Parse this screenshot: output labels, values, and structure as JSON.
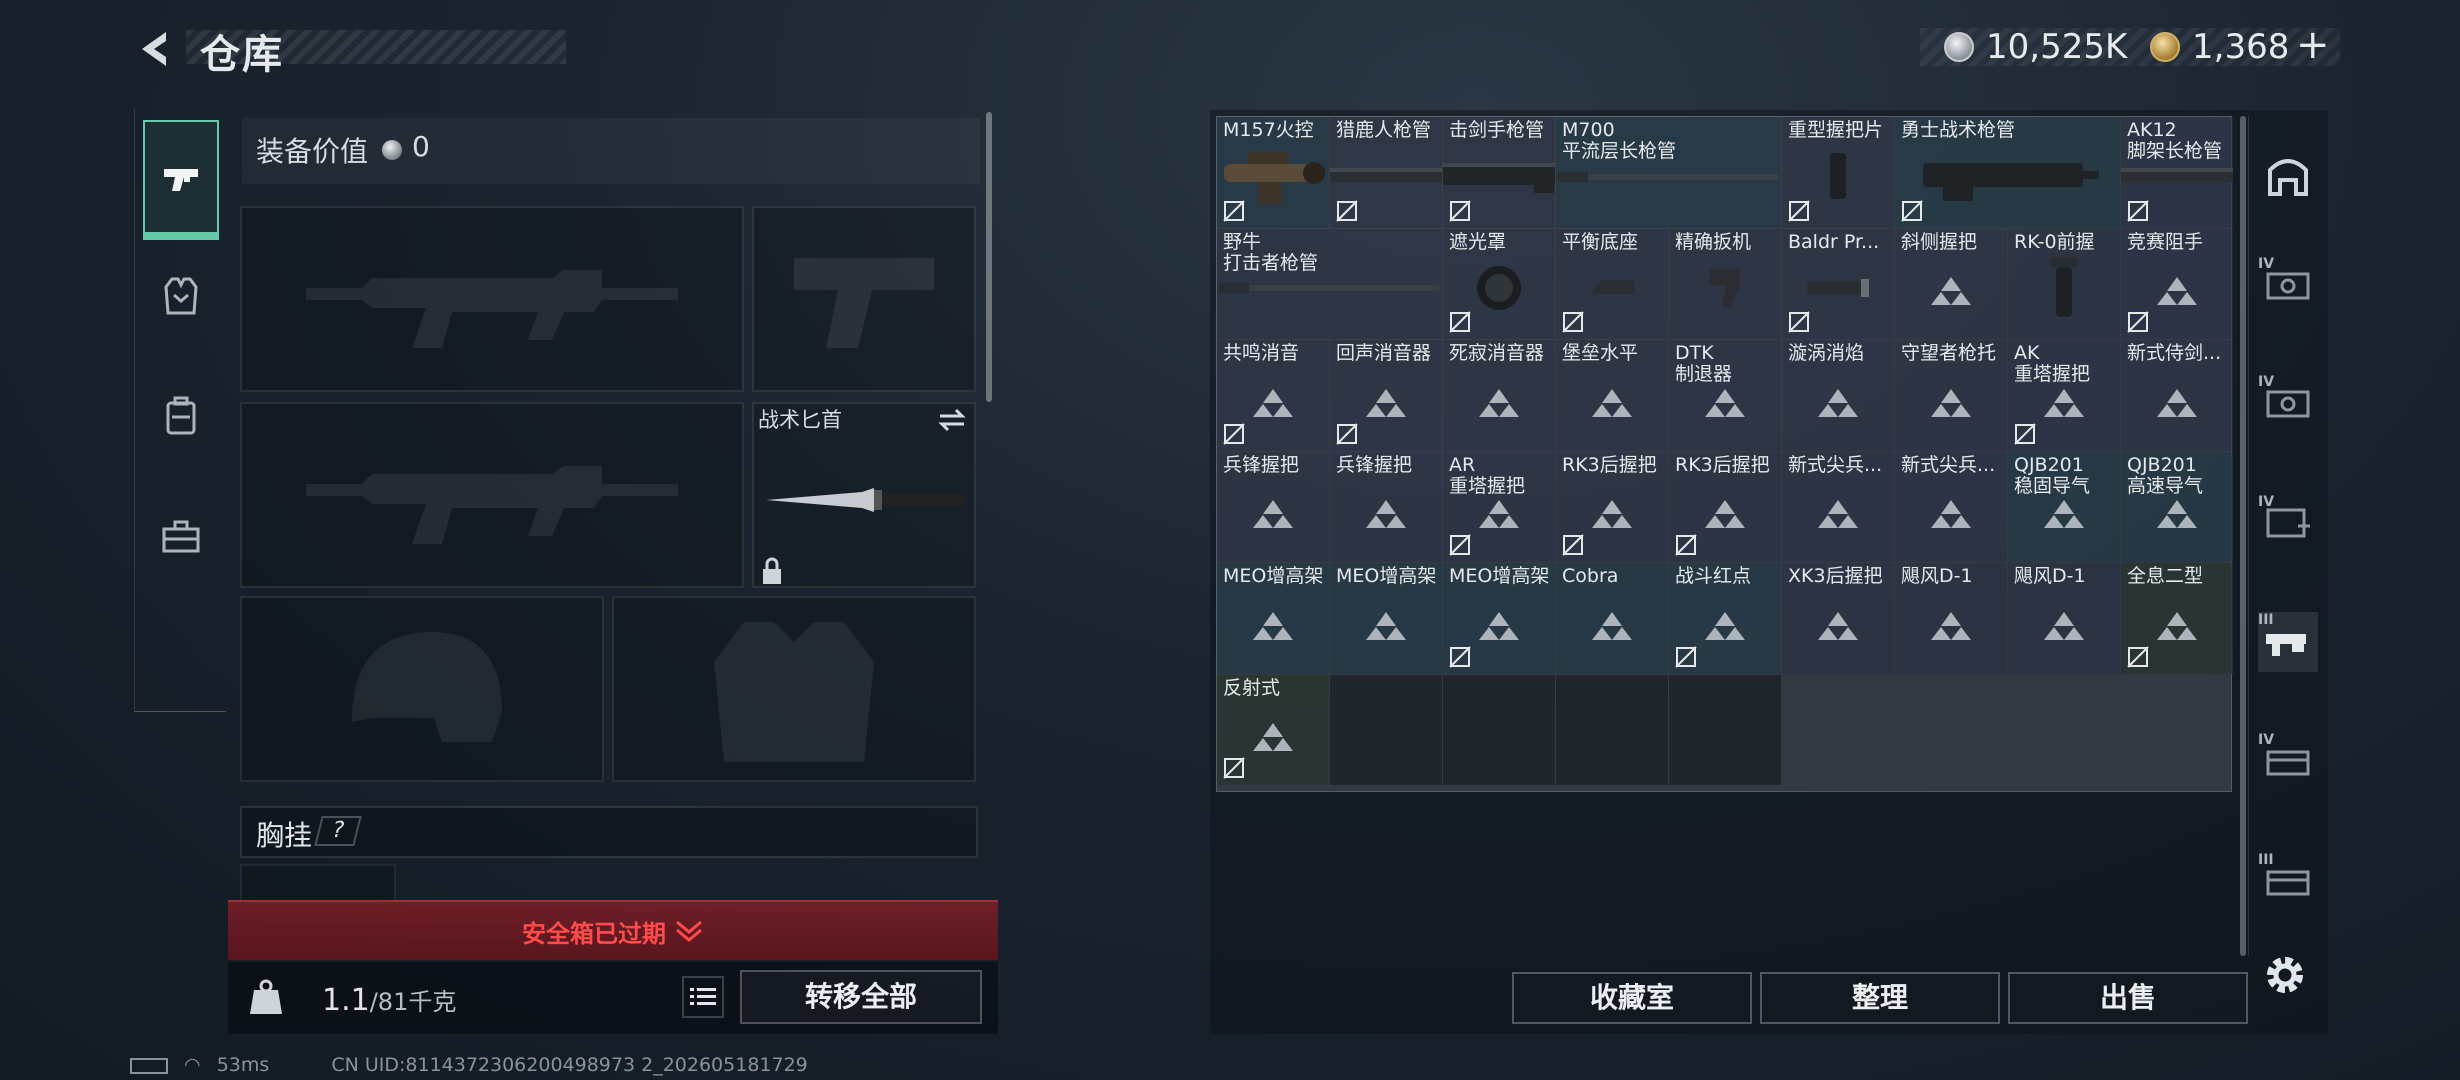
{
  "header": {
    "title": "仓库"
  },
  "currency": {
    "silver": "10,525K",
    "gold": "1,368",
    "plus": "+"
  },
  "loadout": {
    "equip_value_label": "装备价值",
    "equip_value": "0",
    "knife_label": "战术匕首",
    "chest_label": "胸挂",
    "chest_help": "?",
    "safe_expired": "安全箱已过期",
    "weight_current": "1.1",
    "weight_max": "/81千克",
    "transfer_all": "转移全部"
  },
  "inventory": {
    "rows": [
      [
        {
          "name": "M157火控",
          "style": "teal",
          "icon": "scope",
          "flag": true
        },
        {
          "name": "猎鹿人枪管",
          "icon": "rail",
          "flag": true
        },
        {
          "name": "击剑手枪管",
          "icon": "rail-heavy",
          "flag": true
        },
        {
          "name": "M700\n平流层长枪管",
          "style": "teal",
          "icon": "barrel",
          "span": 2
        },
        {
          "name": "重型握把片",
          "icon": "grip-plate",
          "flag": true
        }
      ],
      [
        {
          "name": "勇士战术枪管",
          "style": "teal",
          "icon": "handguard",
          "flag": true,
          "span": 2
        },
        {
          "name": "AK12\n脚架长枪管",
          "icon": "rail",
          "flag": true
        },
        {
          "name": "野牛\n打击者枪管",
          "icon": "barrel",
          "span": 2
        },
        {
          "name": "遮光罩",
          "icon": "hood",
          "flag": true
        },
        {
          "name": "平衡底座",
          "icon": "mount",
          "flag": true
        },
        {
          "name": "精确扳机",
          "icon": "trigger"
        }
      ],
      [
        {
          "name": "Baldr Pr...",
          "icon": "light",
          "flag": true
        },
        {
          "name": "斜侧握把",
          "icon": "placeholder"
        },
        {
          "name": "RK-0前握",
          "icon": "vgrip"
        },
        {
          "name": "竞赛阻手",
          "icon": "placeholder",
          "flag": true
        },
        {
          "name": "共鸣消音",
          "icon": "placeholder",
          "flag": true
        },
        {
          "name": "回声消音器",
          "icon": "placeholder",
          "flag": true
        },
        {
          "name": "死寂消音器",
          "icon": "placeholder"
        },
        {
          "name": "堡垒水平",
          "icon": "placeholder"
        },
        {
          "name": "DTK\n制退器",
          "icon": "placeholder"
        }
      ],
      [
        {
          "name": "漩涡消焰",
          "icon": "placeholder"
        },
        {
          "name": "守望者枪托",
          "icon": "placeholder"
        },
        {
          "name": "AK\n重塔握把",
          "icon": "placeholder",
          "flag": true
        },
        {
          "name": "新式侍剑...",
          "icon": "placeholder"
        },
        {
          "name": "兵锋握把",
          "icon": "placeholder"
        },
        {
          "name": "兵锋握把",
          "icon": "placeholder"
        },
        {
          "name": "AR\n重塔握把",
          "icon": "placeholder",
          "flag": true
        },
        {
          "name": "RK3后握把",
          "icon": "placeholder",
          "flag": true
        },
        {
          "name": "RK3后握把",
          "icon": "placeholder",
          "flag": true
        }
      ],
      [
        {
          "name": "新式尖兵...",
          "icon": "placeholder"
        },
        {
          "name": "新式尖兵...",
          "icon": "placeholder"
        },
        {
          "name": "QJB201\n稳固导气",
          "style": "teal",
          "icon": "placeholder"
        },
        {
          "name": "QJB201\n高速导气",
          "style": "teal",
          "icon": "placeholder"
        },
        {
          "name": "MEO增高架",
          "style": "teal",
          "icon": "placeholder"
        },
        {
          "name": "MEO增高架",
          "style": "teal",
          "icon": "placeholder"
        },
        {
          "name": "MEO增高架",
          "style": "teal",
          "icon": "placeholder",
          "flag": true
        },
        {
          "name": "Cobra",
          "style": "teal",
          "icon": "placeholder"
        },
        {
          "name": "战斗红点",
          "style": "teal",
          "icon": "placeholder",
          "flag": true
        }
      ],
      [
        {
          "name": "XK3后握把",
          "icon": "placeholder"
        },
        {
          "name": "飓风D-1",
          "icon": "placeholder"
        },
        {
          "name": "飓风D-1",
          "icon": "placeholder"
        },
        {
          "name": "全息二型",
          "style": "green",
          "icon": "placeholder",
          "flag": true
        },
        {
          "name": "反射式",
          "style": "green",
          "icon": "placeholder",
          "flag": true
        },
        {
          "name": "",
          "style": "empty"
        },
        {
          "name": "",
          "style": "empty"
        },
        {
          "name": "",
          "style": "empty"
        },
        {
          "name": "",
          "style": "empty"
        }
      ]
    ]
  },
  "filters": [
    {
      "icon": "all-items-icon",
      "tier": ""
    },
    {
      "icon": "armor-rig-icon",
      "tier": "IV"
    },
    {
      "icon": "armor-rig-icon",
      "tier": "IV"
    },
    {
      "icon": "medical-icon",
      "tier": "IV"
    },
    {
      "icon": "attachment-icon",
      "tier": "III"
    },
    {
      "icon": "ammo-box-icon",
      "tier": "IV"
    },
    {
      "icon": "ammo-box-icon",
      "tier": "III"
    }
  ],
  "actions": {
    "collection": "收藏室",
    "sort": "整理",
    "sell": "出售"
  },
  "status": {
    "ping": "53ms",
    "uid": "CN UID:8114372306200498973 2_202605181729"
  }
}
